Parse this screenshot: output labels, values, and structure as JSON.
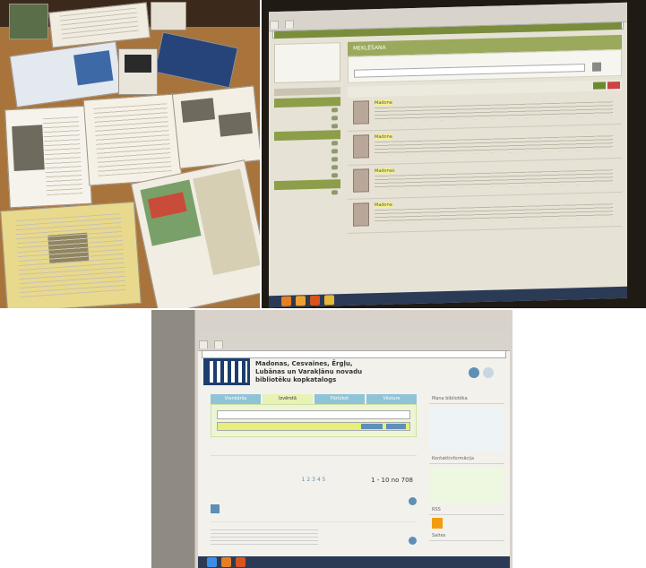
{
  "photos": [
    {
      "name": "books-table"
    },
    {
      "name": "projected-catalog-search"
    },
    {
      "name": "projected-catalog-home"
    }
  ],
  "screen_top": {
    "section_title": "MEKLĒŠANA",
    "results": [
      {
        "title": "Madona"
      },
      {
        "title": "Madona"
      },
      {
        "title": "Madonas"
      },
      {
        "title": "Madona"
      }
    ]
  },
  "screen_bottom": {
    "site_title": "Madonas, Cesvaines, Ērgļu, Lubānas un Varakļānu novadu bibliotēku kopkatalogs",
    "tabs": [
      "Vienkārša",
      "Izvērstā",
      "Pārlūkot",
      "Vēsture"
    ],
    "active_tab": "Izvērstā",
    "right_panel": [
      "Mana bibliotēka",
      "Kontaktinformācija",
      "Saites",
      "RSS"
    ],
    "pager": "1 2 3 4 5",
    "results_count": "1 - 10 no 708",
    "colors": {
      "accent": "#5e8fb5",
      "logo": "#1d3d6e"
    }
  }
}
